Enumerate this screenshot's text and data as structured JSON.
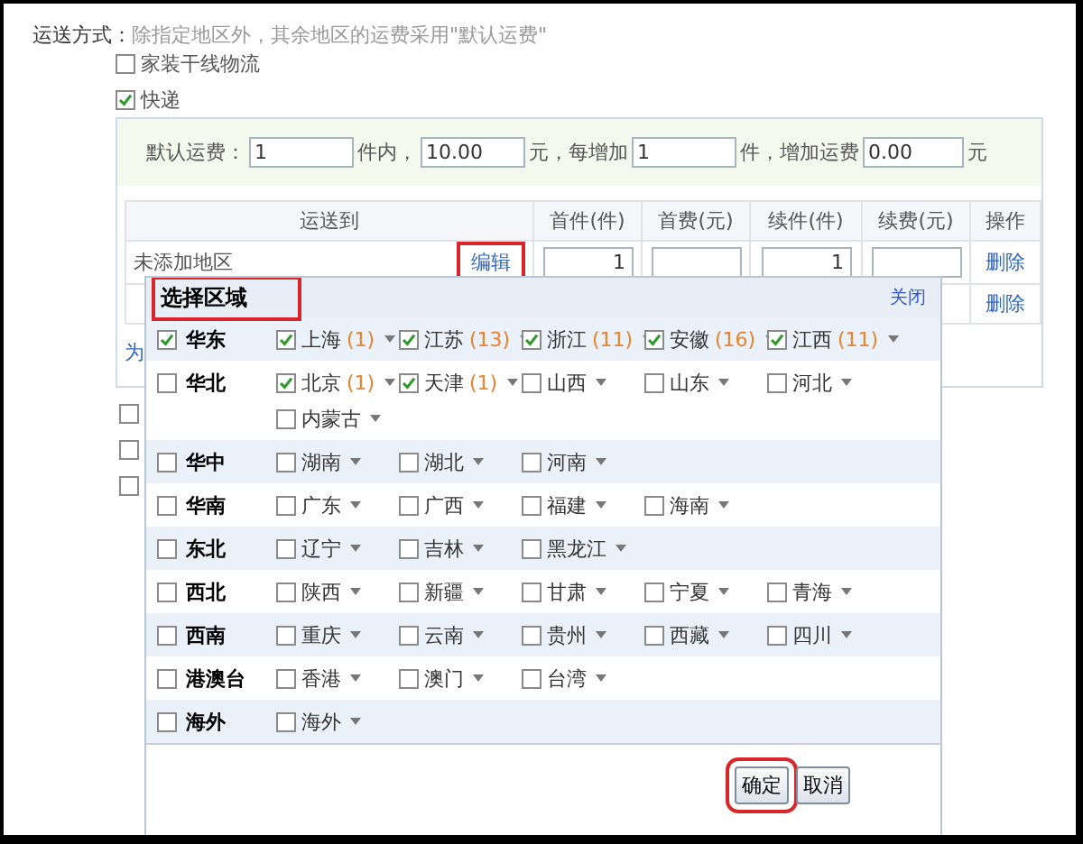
{
  "shipping": {
    "label": "运送方式：",
    "hint": "除指定地区外，其余地区的运费采用\"默认运费\"",
    "methods": [
      {
        "label": "家装干线物流",
        "checked": false
      },
      {
        "label": "快递",
        "checked": true
      }
    ],
    "default_fee": [
      {
        "kind": "text",
        "text": "默认运费："
      },
      {
        "kind": "field",
        "value": "1"
      },
      {
        "kind": "text",
        "text": "件内，"
      },
      {
        "kind": "field",
        "value": "10.00"
      },
      {
        "kind": "text",
        "text": "元，每增加"
      },
      {
        "kind": "field",
        "value": "1"
      },
      {
        "kind": "text",
        "text": "件，增加运费"
      },
      {
        "kind": "field",
        "value": "0.00"
      },
      {
        "kind": "text",
        "text": "元"
      }
    ],
    "table": {
      "columns": [
        "运送到",
        "首件(件)",
        "首费(元)",
        "续件(件)",
        "续费(元)",
        "操作"
      ],
      "rows": [
        {
          "area": "未添加地区",
          "edit": {
            "label": "编辑",
            "highlighted": true
          },
          "first_qty": "1",
          "next_qty": "1",
          "action": "删除"
        },
        {
          "action": "删除"
        }
      ]
    },
    "link": "为",
    "more_options": [
      {
        "checked": false
      },
      {
        "checked": false
      },
      {
        "checked": false
      }
    ]
  },
  "popup": {
    "title": "选择区域",
    "title_highlighted": true,
    "close": "关闭",
    "regions": [
      {
        "name": "华东",
        "checked": true,
        "provinces": [
          {
            "name": "上海",
            "count": "(1)",
            "checked": true
          },
          {
            "name": "江苏",
            "count": "(13)",
            "checked": true
          },
          {
            "name": "浙江",
            "count": "(11)",
            "checked": true
          },
          {
            "name": "安徽",
            "count": "(16)",
            "checked": true
          },
          {
            "name": "江西",
            "count": "(11)",
            "checked": true
          }
        ]
      },
      {
        "name": "华北",
        "checked": false,
        "provinces": [
          {
            "name": "北京",
            "count": "(1)",
            "checked": true
          },
          {
            "name": "天津",
            "count": "(1)",
            "checked": true
          },
          {
            "name": "山西",
            "checked": false
          },
          {
            "name": "山东",
            "checked": false
          },
          {
            "name": "河北",
            "checked": false
          },
          {
            "name": "内蒙古",
            "checked": false
          }
        ]
      },
      {
        "name": "华中",
        "checked": false,
        "provinces": [
          {
            "name": "湖南",
            "checked": false
          },
          {
            "name": "湖北",
            "checked": false
          },
          {
            "name": "河南",
            "checked": false
          }
        ]
      },
      {
        "name": "华南",
        "checked": false,
        "provinces": [
          {
            "name": "广东",
            "checked": false
          },
          {
            "name": "广西",
            "checked": false
          },
          {
            "name": "福建",
            "checked": false
          },
          {
            "name": "海南",
            "checked": false
          }
        ]
      },
      {
        "name": "东北",
        "checked": false,
        "provinces": [
          {
            "name": "辽宁",
            "checked": false
          },
          {
            "name": "吉林",
            "checked": false
          },
          {
            "name": "黑龙江",
            "checked": false
          }
        ]
      },
      {
        "name": "西北",
        "checked": false,
        "provinces": [
          {
            "name": "陕西",
            "checked": false
          },
          {
            "name": "新疆",
            "checked": false
          },
          {
            "name": "甘肃",
            "checked": false
          },
          {
            "name": "宁夏",
            "checked": false
          },
          {
            "name": "青海",
            "checked": false
          }
        ]
      },
      {
        "name": "西南",
        "checked": false,
        "provinces": [
          {
            "name": "重庆",
            "checked": false
          },
          {
            "name": "云南",
            "checked": false
          },
          {
            "name": "贵州",
            "checked": false
          },
          {
            "name": "西藏",
            "checked": false
          },
          {
            "name": "四川",
            "checked": false
          }
        ]
      },
      {
        "name": "港澳台",
        "checked": false,
        "provinces": [
          {
            "name": "香港",
            "checked": false
          },
          {
            "name": "澳门",
            "checked": false
          },
          {
            "name": "台湾",
            "checked": false
          }
        ]
      },
      {
        "name": "海外",
        "checked": false,
        "provinces": [
          {
            "name": "海外",
            "checked": false
          }
        ]
      }
    ],
    "buttons": [
      {
        "label": "确定",
        "highlighted": true
      },
      {
        "label": "取消",
        "highlighted": false
      }
    ]
  }
}
